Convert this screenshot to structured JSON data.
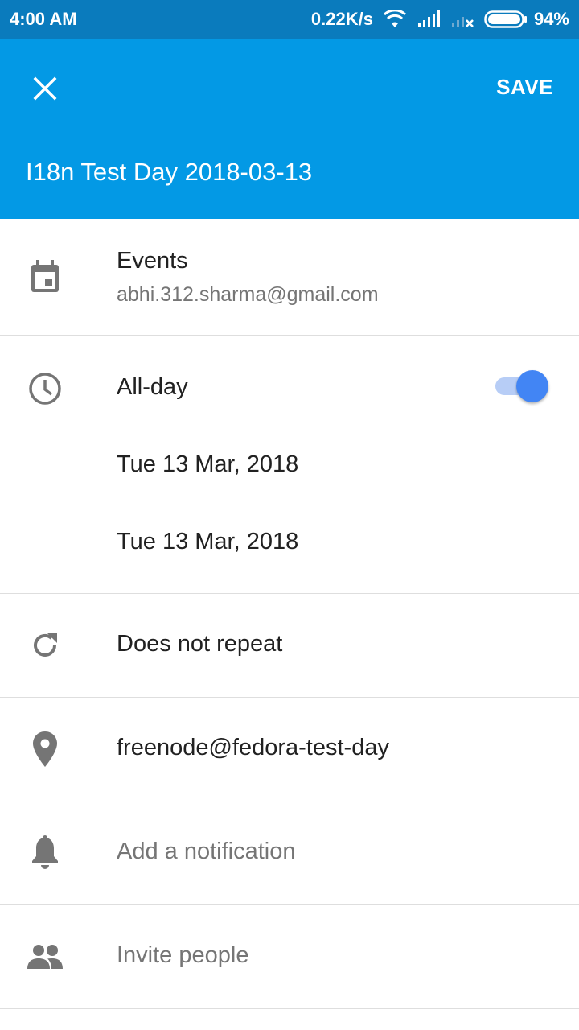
{
  "status_bar": {
    "time": "4:00 AM",
    "speed": "0.22K/s",
    "battery": "94%",
    "icons": [
      "wifi-icon",
      "signal-icon",
      "no-signal-icon",
      "battery-icon"
    ]
  },
  "app_bar": {
    "close_icon": "close-icon",
    "save_label": "SAVE",
    "title": "I18n Test Day 2018-03-13",
    "color": "#0399e5"
  },
  "calendar": {
    "icon": "calendar-icon",
    "name": "Events",
    "account": "abhi.312.sharma@gmail.com"
  },
  "time": {
    "icon": "clock-icon",
    "all_day_label": "All-day",
    "all_day_on": true,
    "start_date": "Tue 13 Mar, 2018",
    "end_date": "Tue 13 Mar, 2018"
  },
  "repeat": {
    "icon": "repeat-icon",
    "label": "Does not repeat"
  },
  "location": {
    "icon": "location-pin-icon",
    "value": "freenode@fedora-test-day"
  },
  "notification": {
    "icon": "bell-icon",
    "placeholder": "Add a notification"
  },
  "people": {
    "icon": "people-icon",
    "placeholder": "Invite people"
  }
}
